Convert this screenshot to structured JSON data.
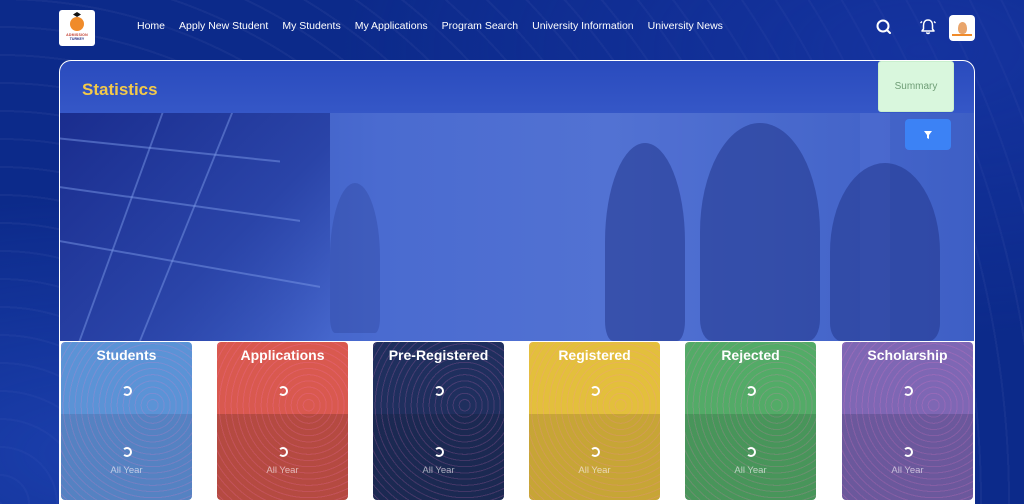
{
  "nav": {
    "logo": {
      "line1": "ADMISSION",
      "line2": "TURKEY"
    },
    "items": [
      {
        "label": "Home"
      },
      {
        "label": "Apply New Student"
      },
      {
        "label": "My Students"
      },
      {
        "label": "My Applications"
      },
      {
        "label": "Program Search"
      },
      {
        "label": "University Information"
      },
      {
        "label": "University News"
      }
    ],
    "icons": [
      "search-icon",
      "bell-icon",
      "user-avatar"
    ]
  },
  "panel": {
    "title": "Statistics",
    "summary_label": "Summary",
    "filter_icon": "filter-icon"
  },
  "cards": [
    {
      "label": "Students",
      "period": "All Year",
      "color_top": "#5b93d6",
      "color_bottom": "#5582c2"
    },
    {
      "label": "Applications",
      "period": "All Year",
      "color_top": "#d9594f",
      "color_bottom": "#b54a41"
    },
    {
      "label": "Pre-Registered",
      "period": "All Year",
      "color_top": "#1f2f5e",
      "color_bottom": "#1b2952"
    },
    {
      "label": "Registered",
      "period": "All Year",
      "color_top": "#e3bf3c",
      "color_bottom": "#c7a536"
    },
    {
      "label": "Rejected",
      "period": "All Year",
      "color_top": "#53ab67",
      "color_bottom": "#48955a"
    },
    {
      "label": "Scholarship",
      "period": "All Year",
      "color_top": "#7e67b4",
      "color_bottom": "#6b589c"
    }
  ],
  "colors": {
    "background": "#0c2a8a",
    "title": "#f3c94a",
    "summary_bg": "#d9f7dd",
    "filter_bg": "#3c82f5"
  }
}
